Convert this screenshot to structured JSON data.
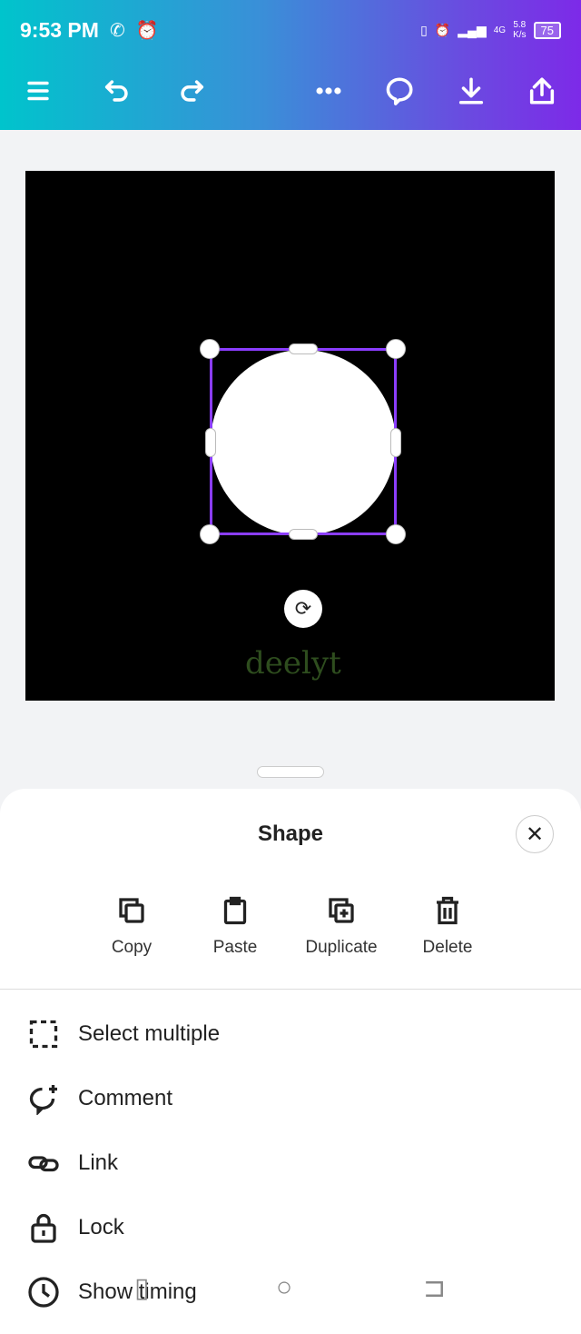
{
  "status_bar": {
    "time": "9:53 PM",
    "network": "4G",
    "speed": "5.8",
    "speed_unit": "K/s",
    "battery": "75"
  },
  "toolbar": {
    "icons": [
      "menu-icon",
      "undo-icon",
      "redo-icon",
      "more-icon",
      "comment-icon",
      "download-icon",
      "share-icon"
    ]
  },
  "canvas": {
    "background": "#000000",
    "logo_text": "deelyt",
    "selection_color": "#8b3dff"
  },
  "sheet": {
    "title": "Shape",
    "actions": [
      {
        "label": "Copy"
      },
      {
        "label": "Paste"
      },
      {
        "label": "Duplicate"
      },
      {
        "label": "Delete"
      }
    ],
    "menu": [
      {
        "label": "Select multiple"
      },
      {
        "label": "Comment"
      },
      {
        "label": "Link"
      },
      {
        "label": "Lock"
      },
      {
        "label": "Show timing"
      }
    ]
  }
}
